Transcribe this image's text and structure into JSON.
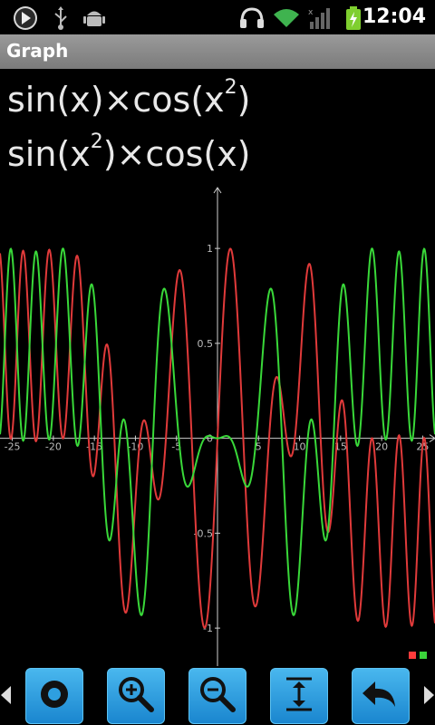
{
  "status_bar": {
    "time": "12:04",
    "icons": [
      "play-icon",
      "usb-icon",
      "android-debug-icon",
      "headphones-icon",
      "wifi-icon",
      "signal-icon",
      "battery-charging-icon"
    ]
  },
  "app": {
    "title": "Graph"
  },
  "formulas": {
    "f1": {
      "prefix": "sin(x)×cos(x",
      "sup": "2",
      "suffix": ")"
    },
    "f2": {
      "prefix": "sin(x",
      "sup": "2",
      "suffix": ")×cos(x)"
    }
  },
  "legend": {
    "colors": [
      "#ff3b3b",
      "#3bd43b"
    ]
  },
  "toolbar": {
    "buttons": [
      "record-icon",
      "zoom-in-icon",
      "zoom-out-icon",
      "fit-vertical-icon",
      "undo-icon"
    ]
  },
  "chart_data": {
    "type": "line",
    "x_ticks": [
      "-25",
      "-20",
      "-15",
      "-10",
      "-5",
      "0",
      "5",
      "10",
      "15",
      "20",
      "25"
    ],
    "y_ticks": [
      "1",
      "0.5",
      "0",
      "-0.5",
      "-1"
    ],
    "xlim": [
      -26.5,
      26.5
    ],
    "ylim": [
      -1.2,
      1.33
    ],
    "series": [
      {
        "expression": "sin(x)×cos(x^2)",
        "color": "#e03a3a"
      },
      {
        "expression": "sin(x^2)×cos(x)",
        "color": "#39d839"
      }
    ]
  }
}
